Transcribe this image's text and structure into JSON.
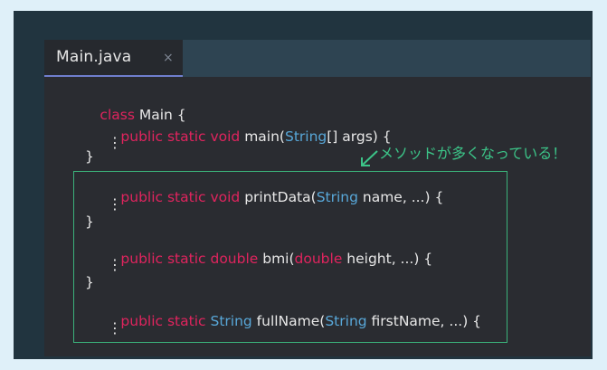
{
  "tab": {
    "title": "Main.java",
    "close": "×"
  },
  "code": {
    "l1": {
      "kw": "class",
      "rest": " Main {"
    },
    "l2": {
      "kw": "public static void",
      "name": " main(",
      "type": "String",
      "rest": "[] args) {"
    },
    "l3": {
      "dots": "⋮"
    },
    "l4": {
      "text": "}"
    },
    "l5": {
      "kw": "public static void",
      "name": " printData(",
      "type": "String",
      "rest": " name, ...) {"
    },
    "l6": {
      "dots": "⋮"
    },
    "l7": {
      "text": "}"
    },
    "l8": {
      "kw1": "public static",
      "kw2": " double",
      "name": " bmi(",
      "kw3": "double",
      "rest": " height, ...) {"
    },
    "l9": {
      "dots": "⋮"
    },
    "l10": {
      "text": "}"
    },
    "l11": {
      "kw": "public static",
      "type1": " String",
      "name": " fullName(",
      "type2": "String",
      "rest": " firstName, ...) {"
    },
    "l12": {
      "dots": "⋮"
    }
  },
  "annotation": {
    "text": "メソッドが多くなっている！"
  },
  "colors": {
    "keyword": "#e0245e",
    "type": "#58a7d8",
    "highlight": "#3bb27a"
  }
}
